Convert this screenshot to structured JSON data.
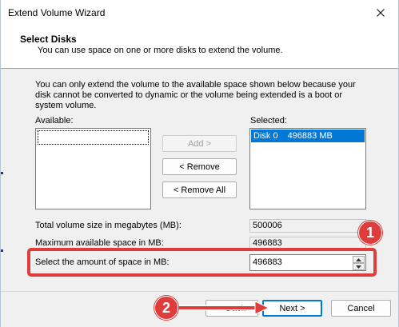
{
  "window": {
    "title": "Extend Volume Wizard",
    "close_glyph": "✕"
  },
  "header": {
    "title": "Select Disks",
    "subtitle": "You can use space on one or more disks to extend the volume."
  },
  "description": "You can only extend the volume to the available space shown below because your disk cannot be converted to dynamic or the volume being extended is a boot or system volume.",
  "available": {
    "label": "Available:",
    "items": [
      ""
    ]
  },
  "selected": {
    "label": "Selected:",
    "items": [
      {
        "disk": "Disk 0",
        "size": "496883 MB"
      }
    ]
  },
  "buttons": {
    "add": "Add >",
    "remove": "< Remove",
    "remove_all": "< Remove All",
    "back": "< Back",
    "next": "Next >",
    "cancel": "Cancel"
  },
  "fields": {
    "total_label": "Total volume size in megabytes (MB):",
    "total_value": "500006",
    "max_label": "Maximum available space in MB:",
    "max_value": "496883",
    "amount_label": "Select the amount of space in MB:",
    "amount_value": "496883"
  },
  "annotations": {
    "step1": "1",
    "step2": "2",
    "accent_color": "#e03c3c"
  },
  "icons": {
    "close": "close-icon",
    "spin_up": "chevron-up-icon",
    "spin_down": "chevron-down-icon",
    "arrow": "arrow-right-icon"
  }
}
